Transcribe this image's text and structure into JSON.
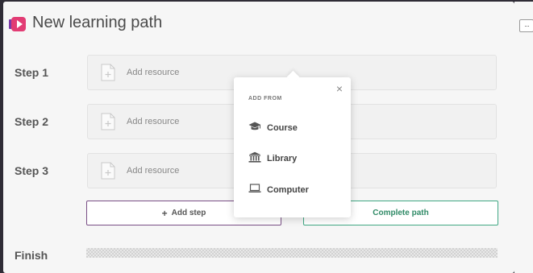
{
  "header": {
    "title": "New learning path",
    "more_label": "···"
  },
  "steps": [
    {
      "label": "Step 1",
      "placeholder": "Add resource"
    },
    {
      "label": "Step 2",
      "placeholder": "Add resource"
    },
    {
      "label": "Step 3",
      "placeholder": "Add resource"
    }
  ],
  "actions": {
    "add_step_plus": "+",
    "add_step": "Add step",
    "complete": "Complete path"
  },
  "finish": {
    "label": "Finish"
  },
  "popover": {
    "close": "×",
    "heading": "ADD FROM",
    "items": [
      {
        "label": "Course",
        "icon": "graduation-cap-icon"
      },
      {
        "label": "Library",
        "icon": "library-icon"
      },
      {
        "label": "Computer",
        "icon": "laptop-icon"
      }
    ]
  },
  "colors": {
    "brand": "#e23c74",
    "add_step_border": "#7a4f86",
    "complete_accent": "#41a884",
    "background": "#2f2c36"
  }
}
